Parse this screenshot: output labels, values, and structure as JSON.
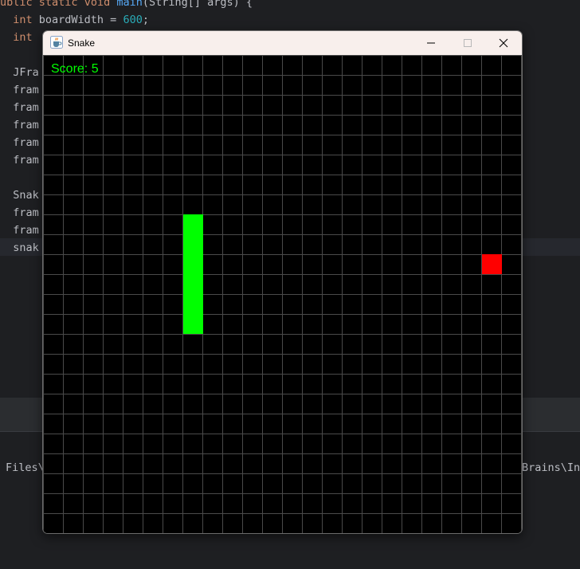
{
  "ide": {
    "code_lines": [
      {
        "segments": [
          {
            "t": "ublic ",
            "c": "kw"
          },
          {
            "t": "static ",
            "c": "kw"
          },
          {
            "t": "void ",
            "c": "kw"
          },
          {
            "t": "main",
            "c": "fn"
          },
          {
            "t": "(String[] args) {",
            "c": ""
          }
        ]
      },
      {
        "segments": [
          {
            "t": "  "
          },
          {
            "t": "int ",
            "c": "kw"
          },
          {
            "t": "boardWidth = "
          },
          {
            "t": "600",
            "c": "num"
          },
          {
            "t": ";"
          }
        ]
      },
      {
        "segments": [
          {
            "t": "  "
          },
          {
            "t": "int",
            "c": "kw"
          }
        ]
      },
      {
        "segments": []
      },
      {
        "segments": [
          {
            "t": "  JFra"
          }
        ]
      },
      {
        "segments": [
          {
            "t": "  fram"
          }
        ]
      },
      {
        "segments": [
          {
            "t": "  fram"
          }
        ]
      },
      {
        "segments": [
          {
            "t": "  fram"
          }
        ]
      },
      {
        "segments": [
          {
            "t": "  fram"
          }
        ]
      },
      {
        "segments": [
          {
            "t": "  fram"
          }
        ]
      },
      {
        "segments": []
      },
      {
        "segments": [
          {
            "t": "  Snak"
          }
        ]
      },
      {
        "segments": [
          {
            "t": "  fram"
          }
        ]
      },
      {
        "segments": [
          {
            "t": "  fram"
          }
        ]
      },
      {
        "segments": [
          {
            "t": "  snak"
          }
        ]
      }
    ],
    "console_left": "Files\\",
    "console_right": "Brains\\In"
  },
  "window": {
    "title": "Snake",
    "icon": "java-cup-icon",
    "controls": [
      "minimize-icon",
      "maximize-icon",
      "close-icon"
    ]
  },
  "game": {
    "score_label": "Score: 5",
    "grid_cells": 24,
    "snake_cells": [
      [
        7,
        8
      ],
      [
        7,
        9
      ],
      [
        7,
        10
      ],
      [
        7,
        11
      ],
      [
        7,
        12
      ],
      [
        7,
        13
      ]
    ],
    "food_cell": [
      22,
      10
    ],
    "colors": {
      "background": "#000000",
      "grid": "#4a4a4a",
      "snake": "#00ff00",
      "food": "#ff0000",
      "score": "#00ff00"
    }
  }
}
